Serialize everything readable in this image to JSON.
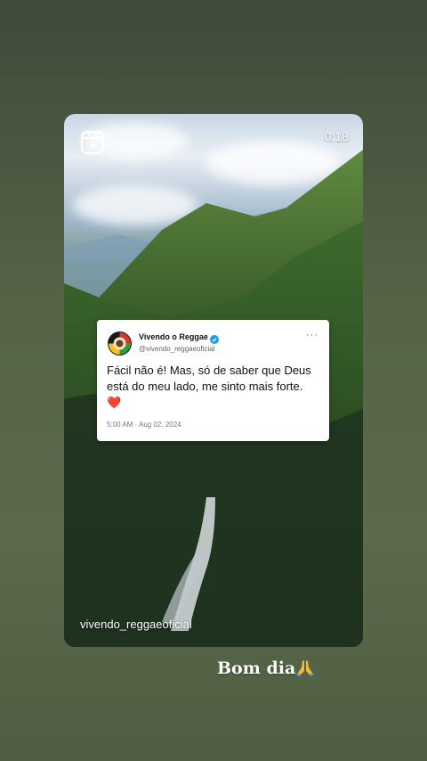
{
  "reel": {
    "duration": "0:18",
    "username": "vivendo_reggaeoficial",
    "icon": "reels-icon"
  },
  "tweet": {
    "display_name": "Vivendo o Reggae",
    "handle": "@vivendo_reggaeoficial",
    "text": "Fácil não é! Mas, só de saber que Deus está do meu lado, me sinto mais forte.",
    "emoji": "❤️",
    "timestamp": "5:00 AM · Aug 02, 2024",
    "more_icon": "more-horizontal-icon",
    "verified_color": "#1d9bf0"
  },
  "caption": {
    "text": "Bom dia",
    "emoji_icon": "praying-hands-icon"
  }
}
